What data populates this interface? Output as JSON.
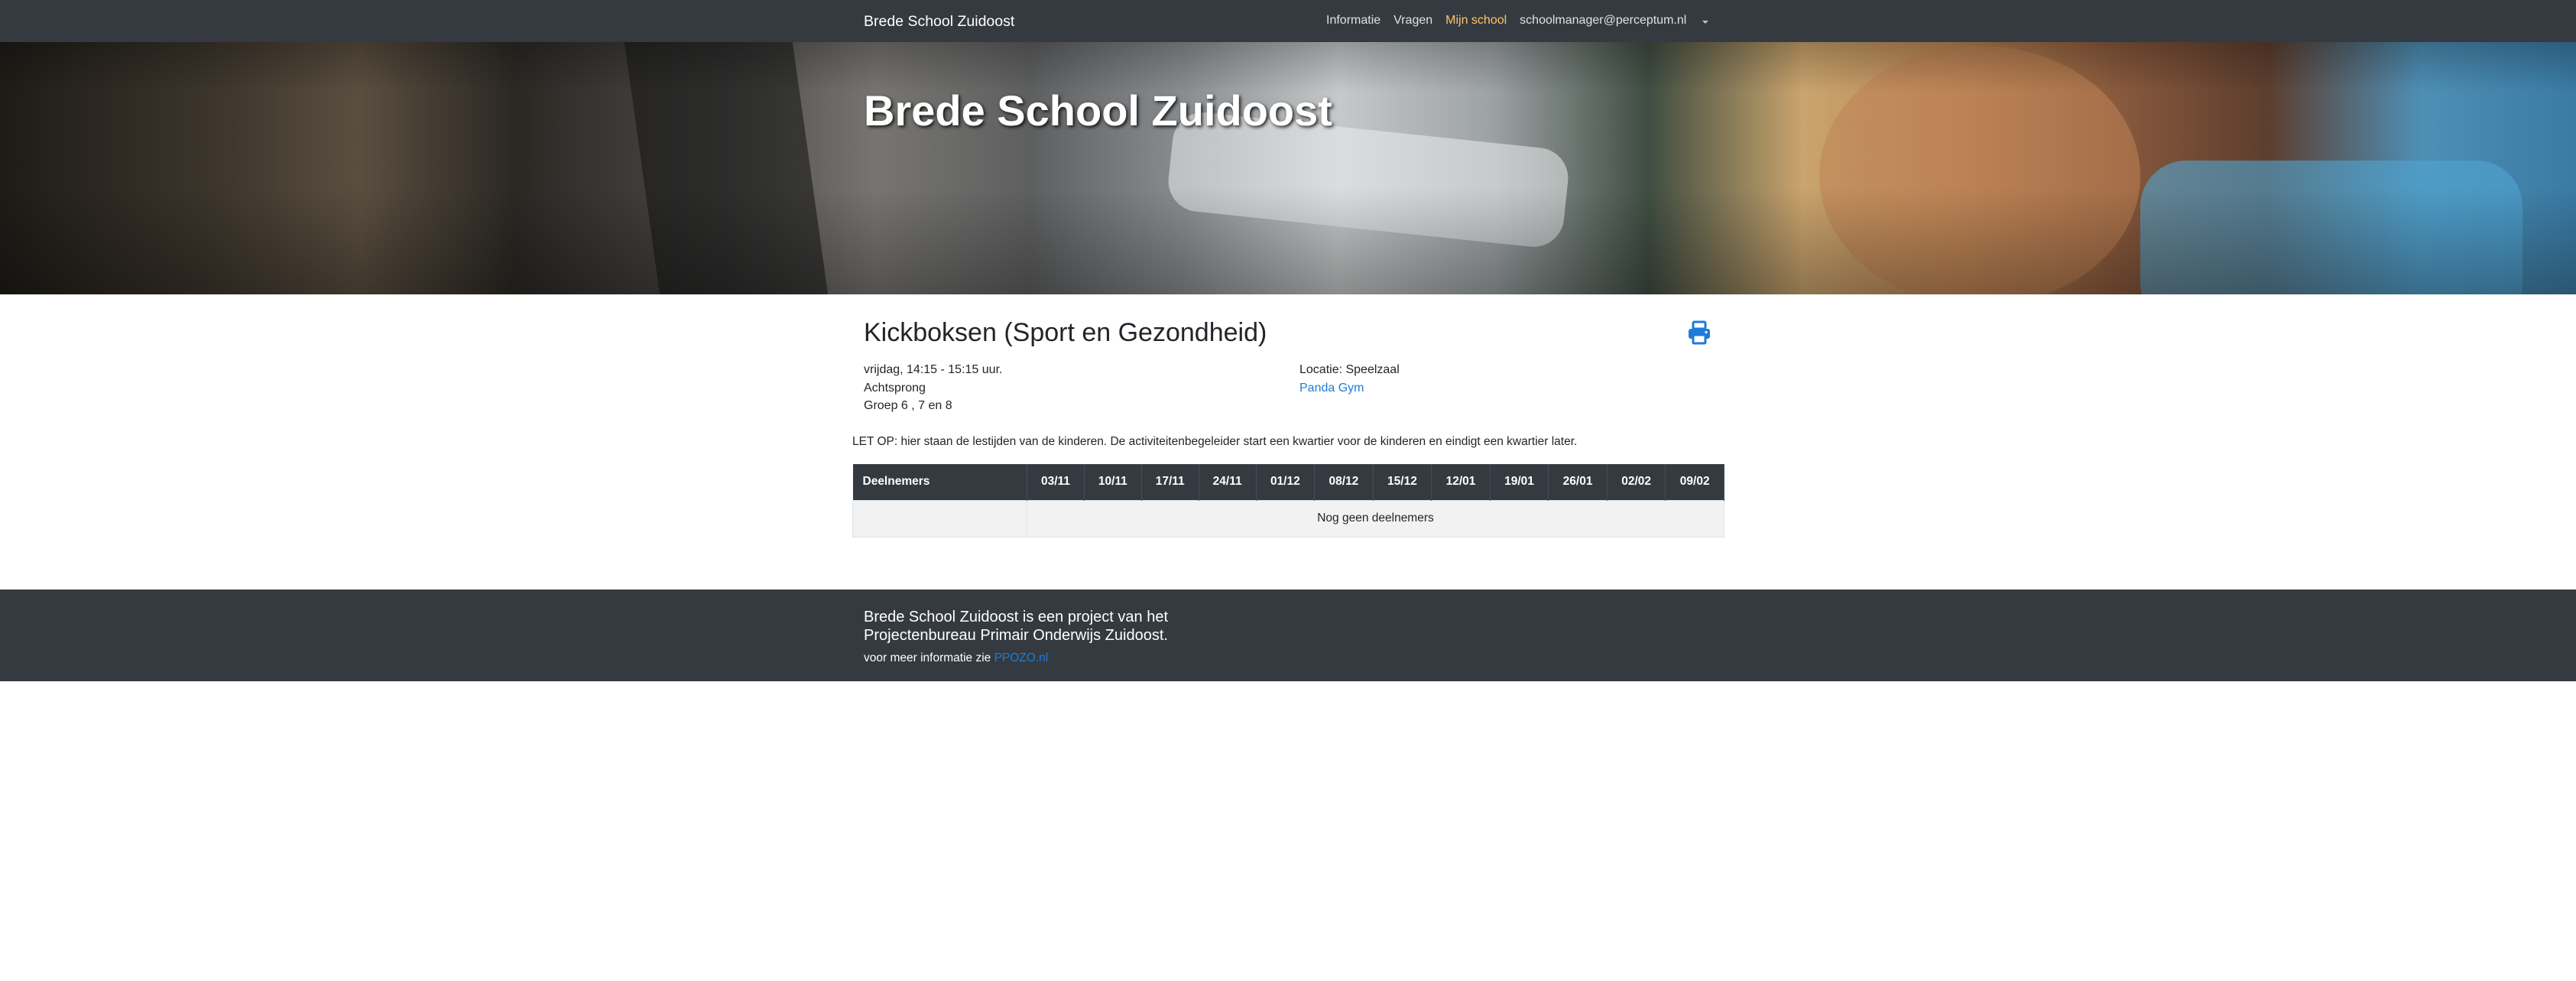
{
  "navbar": {
    "brand": "Brede School Zuidoost",
    "links": [
      {
        "label": "Informatie"
      },
      {
        "label": "Vragen"
      },
      {
        "label": "Mijn school"
      },
      {
        "label": "schoolmanager@perceptum.nl"
      }
    ],
    "active_color": "#ffc46b"
  },
  "hero": {
    "title": "Brede School Zuidoost"
  },
  "activity": {
    "title": "Kickboksen (Sport en Gezondheid)",
    "print_icon": "print-icon",
    "time": "vrijdag, 14:15 - 15:15 uur.",
    "provider": "Achtsprong",
    "groups": "Groep 6 , 7 en 8",
    "location": "Locatie: Speelzaal",
    "location_link": "Panda Gym"
  },
  "notice": "LET OP: hier staan de lestijden van de kinderen. De activiteitenbegeleider start een kwartier voor de kinderen en eindigt een kwartier later.",
  "table": {
    "header_first": "Deelnemers",
    "dates": [
      "03/11",
      "10/11",
      "17/11",
      "24/11",
      "01/12",
      "08/12",
      "15/12",
      "12/01",
      "19/01",
      "26/01",
      "02/02",
      "09/02"
    ],
    "empty_message": "Nog geen deelnemers",
    "header_color": "#343a40"
  },
  "footer": {
    "title": "Brede School Zuidoost is een project van het Projectenbureau Primair Onderwijs Zuidoost.",
    "more_text": "voor meer informatie zie ",
    "more_link": "PPOZO.nl"
  },
  "colors": {
    "link": "#1e7bd8",
    "dark": "#343a40"
  }
}
